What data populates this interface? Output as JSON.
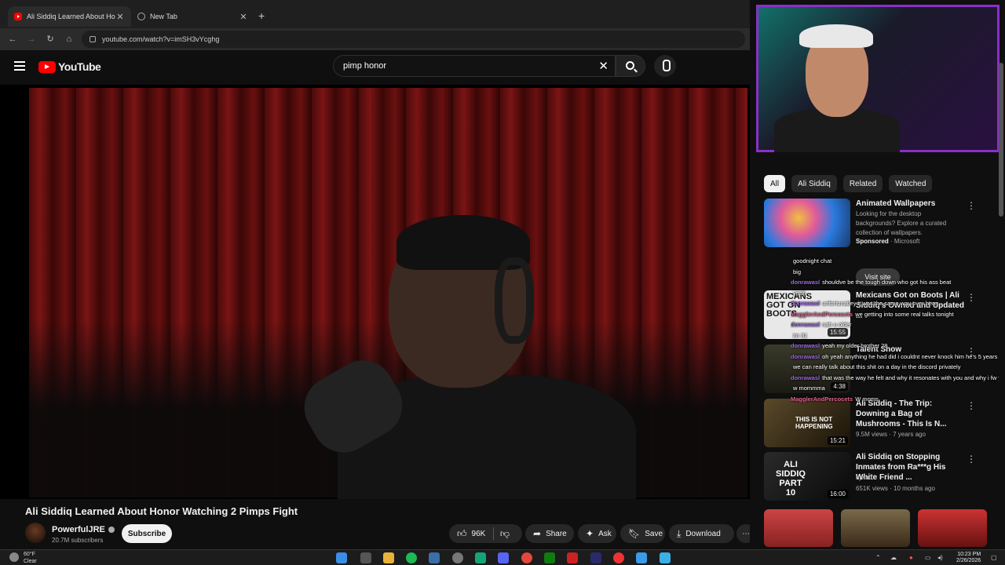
{
  "browser": {
    "tabs": [
      {
        "title": "Ali Siddiq Learned About Honor",
        "active": true
      },
      {
        "title": "New Tab",
        "active": false
      }
    ],
    "url": "youtube.com/watch?v=imSH3vYcghg"
  },
  "youtube": {
    "logo_text": "YouTube",
    "search_value": "pimp honor"
  },
  "video": {
    "title": "Ali Siddiq Learned About Honor Watching 2 Pimps Fight",
    "channel": "PowerfulJRE",
    "subscribers": "20.7M subscribers",
    "subscribe_label": "Subscribe",
    "likes": "96K",
    "share_label": "Share",
    "ask_label": "Ask",
    "save_label": "Save",
    "download_label": "Download"
  },
  "sidebar": {
    "chips": [
      "All",
      "Ali Siddiq",
      "Related",
      "Watched"
    ],
    "recommendations": [
      {
        "title": "Animated Wallpapers",
        "desc": "Looking for the desktop backgrounds? Explore a curated collection of wallpapers.",
        "sponsor": "Sponsored",
        "advertiser": "Microsoft",
        "action": "Visit site"
      },
      {
        "title": "Mexicans Got on Boots | Ali Siddiq's Owned and Updated ...",
        "duration": "15:55",
        "thumb_text": "MEXICANS GOT ON BOOTS"
      },
      {
        "title": "Talent Show",
        "duration": "4:38"
      },
      {
        "title": "Ali Siddiq - The Trip: Downing a Bag of Mushrooms - This Is N...",
        "meta": "9.5M views · 7 years ago",
        "duration": "15:21",
        "thumb_text": "THIS IS NOT HAPPENING"
      },
      {
        "title": "Ali Siddiq on Stopping Inmates from Ra***g His White Friend ...",
        "channel": "djvlad",
        "meta": "651K views · 10 months ago",
        "duration": "16:00",
        "thumb_text": "ALI SIDDIQ PART 10"
      }
    ]
  },
  "chat": [
    {
      "user": "",
      "text": "goodnight chat"
    },
    {
      "user": "",
      "text": "big"
    },
    {
      "user": "donrawasl",
      "text": "shouldve be the tough down who got his ass beat"
    },
    {
      "user": "",
      "text": "yeah"
    },
    {
      "user": "donrawasl",
      "text": "unfortunatley it was the same way over here"
    },
    {
      "user": "MagglerAndPercocets",
      "text": "we getting into some real talks tonight"
    },
    {
      "user": "donrawasl",
      "text": "nah u older"
    },
    {
      "user": "",
      "text": "im 31"
    },
    {
      "user": "donrawasl",
      "text": "yeah my older brother 28"
    },
    {
      "user": "donrawasl",
      "text": "oh yeah anything he had did i couldnt never knock him he's 5 years"
    },
    {
      "user": "",
      "text": "we can really talk about this shit on a day in the discord privately"
    },
    {
      "user": "donrawasl",
      "text": "that was the way he felt and why it resonates with you and why i fw you so much"
    },
    {
      "user": "",
      "text": "w mommma"
    },
    {
      "user": "MagglerAndPercocets",
      "text": "W moms"
    }
  ],
  "taskbar": {
    "weather_temp": "60°F",
    "weather_desc": "Clear",
    "time": "10:23 PM",
    "date": "2/26/2026"
  },
  "colors": {
    "youtube_red": "#ff0000",
    "background": "#0f0f0f",
    "stream_border": "#8a2fc8"
  }
}
